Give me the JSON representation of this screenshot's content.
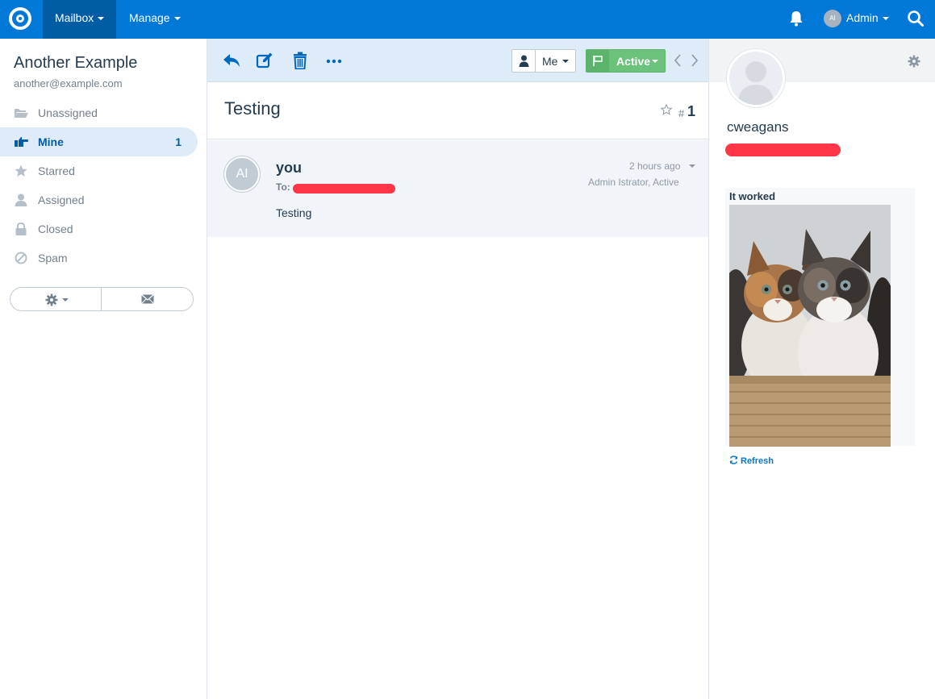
{
  "topnav": {
    "mailbox_label": "Mailbox",
    "manage_label": "Manage",
    "user_initials": "AI",
    "user_name": "Admin"
  },
  "sidebar": {
    "mailbox_name": "Another Example",
    "mailbox_email": "another@example.com",
    "folders": [
      {
        "label": "Unassigned",
        "icon": "folder-open-icon",
        "count": ""
      },
      {
        "label": "Mine",
        "icon": "hand-point-icon",
        "count": "1",
        "active": true
      },
      {
        "label": "Starred",
        "icon": "star-icon",
        "count": ""
      },
      {
        "label": "Assigned",
        "icon": "user-icon",
        "count": ""
      },
      {
        "label": "Closed",
        "icon": "lock-icon",
        "count": ""
      },
      {
        "label": "Spam",
        "icon": "ban-icon",
        "count": ""
      }
    ]
  },
  "toolbar": {
    "assignee_label": "Me",
    "status_label": "Active"
  },
  "conversation": {
    "subject": "Testing",
    "number_hash": "#",
    "number": "1"
  },
  "thread": {
    "avatar_initials": "AI",
    "from": "you",
    "to_label": "To:",
    "time": "2 hours ago",
    "meta": "Admin Istrator, Active",
    "body": "Testing"
  },
  "customer": {
    "name": "cweagans",
    "widget_title": "It worked",
    "refresh_label": "Refresh"
  },
  "colors": {
    "nav_blue": "#0078d7",
    "nav_active": "#005ca3",
    "active_green": "#6ac27b",
    "redaction_red": "#ff3548"
  }
}
